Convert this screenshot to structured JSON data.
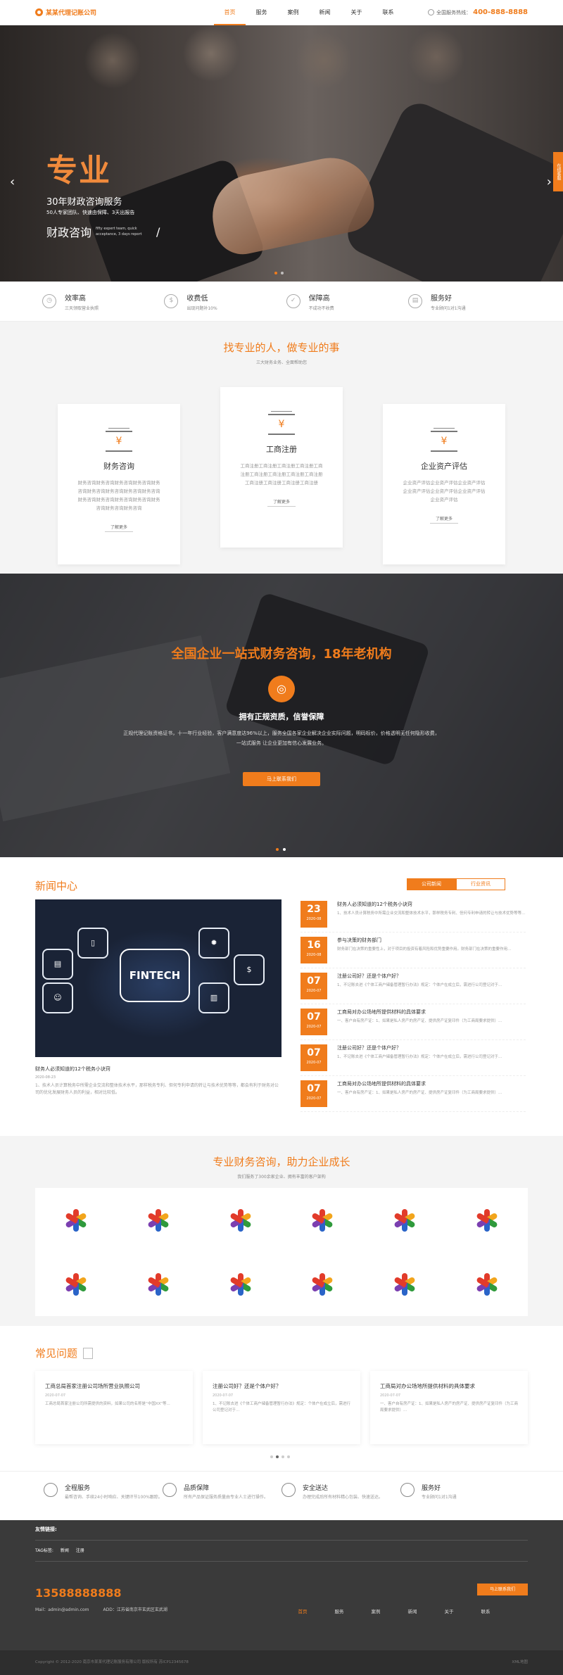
{
  "header": {
    "logo": "某某代理记账公司",
    "nav": [
      "首页",
      "服务",
      "案例",
      "新闻",
      "关于",
      "联系"
    ],
    "hotline_label": "全国服务热线：",
    "hotline": "400-888-8888"
  },
  "banner": {
    "big": "专业",
    "line1": "30年财政咨询服务",
    "line2": "50人专家团队、快速由保障、3天出报告",
    "line3": "财政咨询",
    "line3_small": "fifty expert team, quick acceptance, 3 days report",
    "slash": "/",
    "side_tab": "在线客服",
    "prev": "‹",
    "next": "›"
  },
  "features": [
    {
      "icon": "clock-icon",
      "title": "效率高",
      "sub": "三天领取营业执照"
    },
    {
      "icon": "money-icon",
      "title": "收费低",
      "sub": "出现问题补10%"
    },
    {
      "icon": "shield-icon",
      "title": "保障高",
      "sub": "不成功不收费"
    },
    {
      "icon": "chart-icon",
      "title": "服务好",
      "sub": "专业顾问1对1沟通"
    }
  ],
  "services": {
    "title": "找专业的人，做专业的事",
    "sub": "三大财务业务、全面帮助您",
    "cards": [
      {
        "name": "财务咨询",
        "desc": "财务咨询财务咨询财务咨询财务咨询财务咨询财务咨询财务咨询财务咨询财务咨询财务咨询财务咨询财务咨询财务咨询财务咨询财务咨询财务咨询",
        "more": "了解更多"
      },
      {
        "name": "工商注册",
        "desc": "工商注册工商注册工商注册工商注册工商注册工商注册工商注册工商注册工商注册工商注册工商注册工商注册工商注册",
        "more": "了解更多"
      },
      {
        "name": "企业资产评估",
        "desc": "企业资产评估企业资产评估企业资产评估企业资产评估企业资产评估企业资产评估企业资产评估",
        "more": "了解更多"
      }
    ]
  },
  "promo": {
    "title": "全国企业一站式财务咨询，18年老机构",
    "icon": "target-icon",
    "sub": "拥有正规资质，信誉保障",
    "desc": "正规代理记账资格证书，十一年行业经验，客户满意度达96%以上，服务全国各家企业解决企业实际问题，明码标价，价格透明无任何隐形收费，一站式服务 让企业更加有信心发展业务。",
    "button": "马上联系我们"
  },
  "news": {
    "title": "新闻中心",
    "tabs": [
      "公司新闻",
      "行业资讯"
    ],
    "image_text": "FINTECH",
    "feature_title": "财务人必须知道的12个税务小诀窍",
    "feature_date": "2020-08-23",
    "feature_desc": "1、技术人员计算税务中所需企业交流和整体技术水平，那样税务专利、但何专利申请的转让与技术优势等等，都会有利于财务对公司的优化发展财务人员的利益，相对比较低。",
    "items": [
      {
        "day": "23",
        "ym": "2020-08",
        "title": "财务人必须知道的12个税务小诀窍",
        "desc": "1、技术人员计算税务中所需企业交流和整体技术水平，那样税务专利、但何专利申请的转让与技术优势等等..."
      },
      {
        "day": "16",
        "ym": "2020-08",
        "title": "参与决策的财务部门",
        "desc": "财务部门在决策的重要性上，对于项目的投资有着风险和优势重要作用。财务部门在决策的重要作用..."
      },
      {
        "day": "07",
        "ym": "2020-07",
        "title": "注册公司好？还是个体户好？",
        "desc": "1、不记账去进《个体工商户储备管理暂行办法》规定：个体户在成立后，需进行公司登记对于..."
      },
      {
        "day": "07",
        "ym": "2020-07",
        "title": "工商局对办公场地所提供材料的具体要求",
        "desc": "一、客户自有房产证：1、如果是私人房产的房产证、提供房产证复印件（为工商局要求提供）..."
      },
      {
        "day": "07",
        "ym": "2020-07",
        "title": "注册公司好？还是个体户好？",
        "desc": "1、不记账去进《个体工商户储备管理暂行办法》规定：个体户在成立后，需进行公司登记对于..."
      },
      {
        "day": "07",
        "ym": "2020-07",
        "title": "工商局对办公场地所提供材料的具体要求",
        "desc": "一、客户自有房产证：1、如果是私人房产的房产证、提供房产证复印件（为工商局要求提供）..."
      }
    ]
  },
  "partners": {
    "title": "专业财务咨询，助力企业成长",
    "sub": "我们服务了300余家企业、拥有丰富的客户架构"
  },
  "faq": {
    "title": "常见问题",
    "items": [
      {
        "title": "工商总局首家注册公司场所营业执照公司",
        "date": "2020-07-07",
        "desc": "工商总局首家注册公司所需提供的资料，如果公司的名称是“中国XX”等..."
      },
      {
        "title": "注册公司好？还是个体户好？",
        "date": "2020-07-07",
        "desc": "1、不记账去进《个体工商户储备管理暂行办法》规定：个体户在成立后，需进行公司登记对于..."
      },
      {
        "title": "工商局对办公场地所提供材料的具体要求",
        "date": "2020-07-07",
        "desc": "一、客户自有房产证：1、如果是私人房产的房产证、提供房产证复印件（为工商局要求提供）..."
      }
    ]
  },
  "guarantees": [
    {
      "title": "全程服务",
      "desc": "最帮咨询、手续24小时响应、关键环节100%跟踪。"
    },
    {
      "title": "品质保障",
      "desc": "所有产品保证服务质量由专业人士进行操作。"
    },
    {
      "title": "安全送达",
      "desc": "办理完成后所有材料精心包装、快速送达。"
    },
    {
      "title": "服务好",
      "desc": "专业顾问1对1沟通"
    }
  ],
  "footer": {
    "links_label": "友情链接:",
    "tags_label": "TAG标签:",
    "tags": [
      "新闻",
      "注册"
    ],
    "phone": "13588888888",
    "mail": "Mail：admin@admin.com",
    "addr": "ADD：江苏省南京市玄武区玄武湖",
    "button": "马上联系我们",
    "nav": [
      "首页",
      "服务",
      "案例",
      "新闻",
      "关于",
      "联系"
    ],
    "copyright": "Copyright © 2012-2020 南京市某某代理记账服务有限公司 版权所有 苏ICP12345678",
    "sitemap": "XML地图"
  },
  "colors": {
    "accent": "#f07c1c",
    "footer": "#3a3a3a"
  }
}
